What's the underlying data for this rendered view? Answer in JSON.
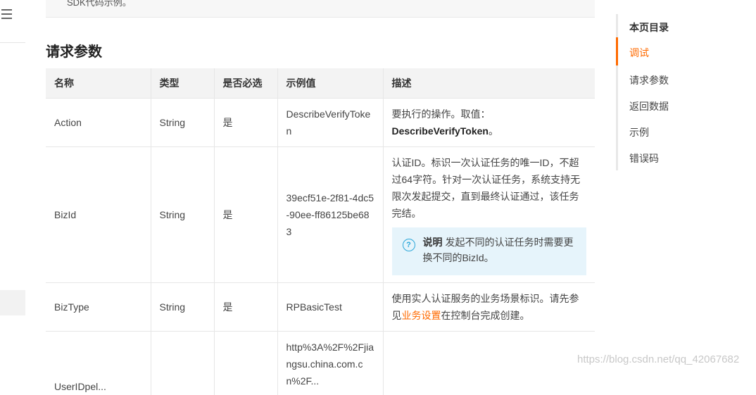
{
  "top_note": "SDK代码示例。",
  "section_title": "请求参数",
  "table": {
    "headers": [
      "名称",
      "类型",
      "是否必选",
      "示例值",
      "描述"
    ],
    "rows": [
      {
        "name": "Action",
        "type": "String",
        "required": "是",
        "example": "DescribeVerifyToken",
        "desc": "要执行的操作。取值：",
        "desc_bold": "DescribeVerifyToken",
        "desc_tail": "。"
      },
      {
        "name": "BizId",
        "type": "String",
        "required": "是",
        "example": "39ecf51e-2f81-4dc5-90ee-ff86125be683",
        "desc": "认证ID。标识一次认证任务的唯一ID，不超过64字符。针对一次认证任务，系统支持无限次发起提交，直到最终认证通过，该任务完结。",
        "note_label": "说明",
        "note_text": "发起不同的认证任务时需要更换不同的BizId。"
      },
      {
        "name": "BizType",
        "type": "String",
        "required": "是",
        "example": "RPBasicTest",
        "desc_pre": "使用实人认证服务的业务场景标识。请先参见",
        "desc_link": "业务设置",
        "desc_post": "在控制台完成创建。"
      },
      {
        "name": "UserIDpel...",
        "type": "",
        "required": "",
        "example": "http%3A%2F%2Fjiangsu.china.com.cn%2F...",
        "desc": ""
      }
    ]
  },
  "toc": {
    "title": "本页目录",
    "items": [
      "调试",
      "请求参数",
      "返回数据",
      "示例",
      "错误码"
    ],
    "active_index": 0
  },
  "watermark": "https://blog.csdn.net/qq_42067682",
  "colors": {
    "accent": "#ff6a00",
    "note_bg": "#e6f4fb",
    "note_icon": "#2aa6d9"
  }
}
